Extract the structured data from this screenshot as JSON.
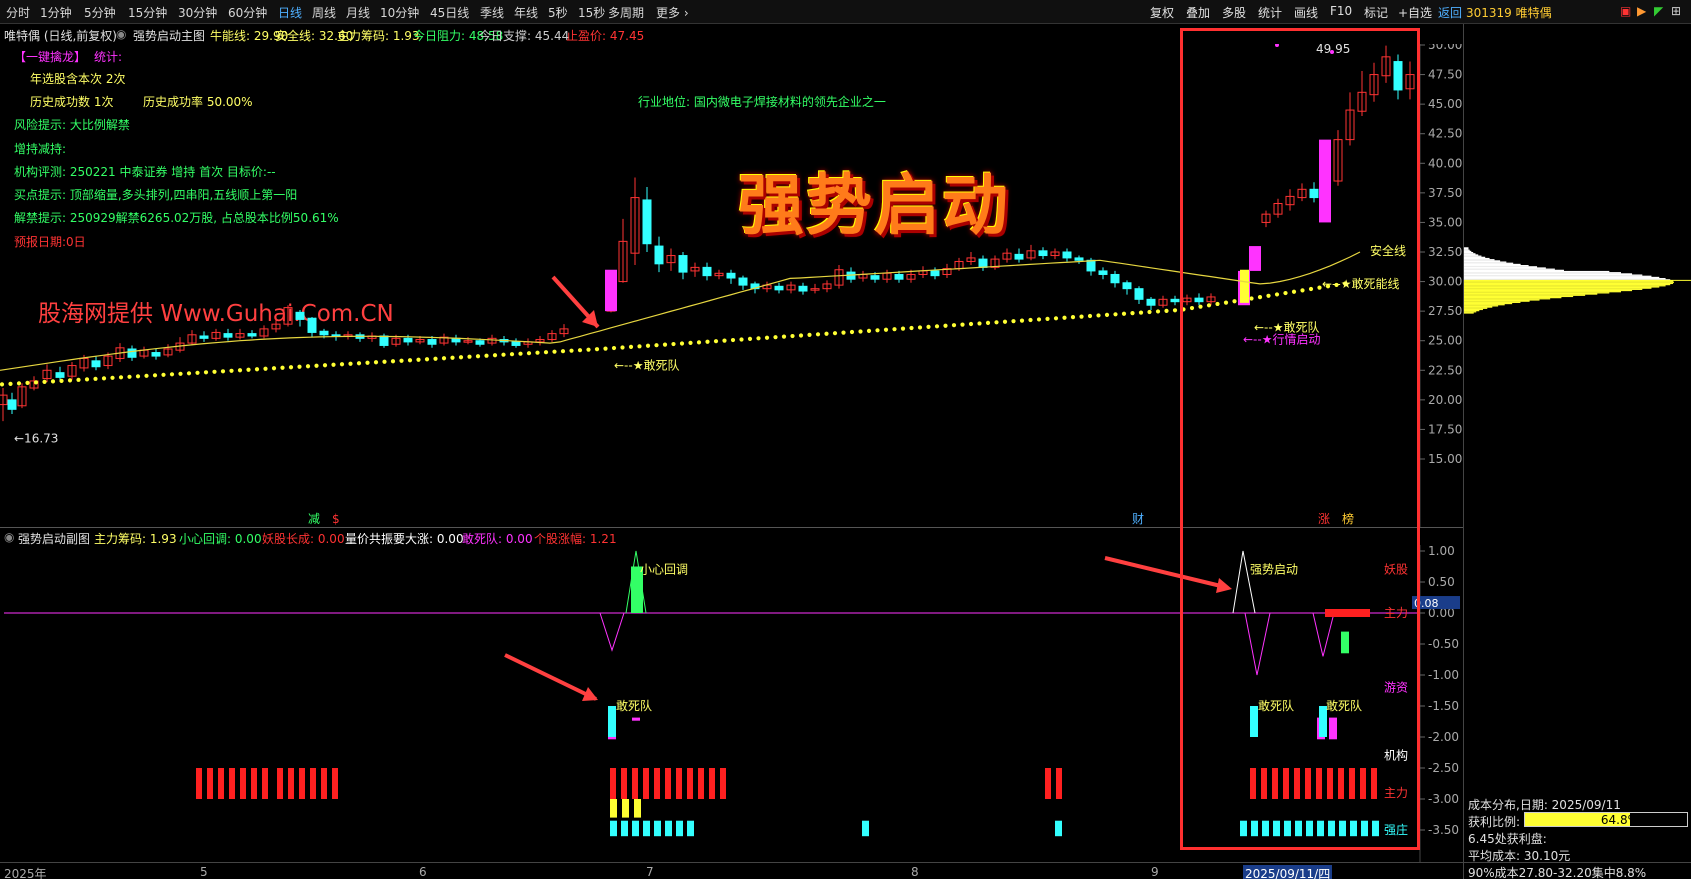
{
  "toolbar": {
    "periods": [
      "分时",
      "1分钟",
      "5分钟",
      "15分钟",
      "30分钟",
      "60分钟",
      "日线",
      "周线",
      "月线",
      "10分钟",
      "45日线",
      "季线",
      "年线",
      "5秒",
      "15秒",
      "多周期",
      "更多 ›"
    ],
    "active": "日线",
    "right_items": [
      "复权",
      "叠加",
      "多股",
      "统计",
      "画线",
      "F10",
      "标记",
      "+自选",
      "返回"
    ]
  },
  "stock": {
    "code_name": "301319 唯特偶"
  },
  "header": {
    "title": "唯特偶 (日线,前复权)",
    "indicator": "强势启动主图",
    "items": [
      {
        "label": "牛能线:",
        "value": "29.90",
        "color": "#ffff66"
      },
      {
        "label": "安全线:",
        "value": "32.60",
        "color": "#ffff66"
      },
      {
        "label": "主力筹码:",
        "value": "1.93",
        "color": "#ffff66"
      },
      {
        "label": "今日阻力:",
        "value": "48.58",
        "color": "#33ff66"
      },
      {
        "label": "今日支撑:",
        "value": "45.44",
        "color": "#cccccc"
      },
      {
        "label": "止盈价:",
        "value": "47.45",
        "color": "#ff3333"
      }
    ]
  },
  "info": {
    "tag": "【一键擒龙】",
    "stat": "统计:",
    "year_count": "年选股含本次 2次",
    "success_count": "历史成功数 1次",
    "success_rate": "历史成功率 50.00%",
    "risk": "风险提示: 大比例解禁",
    "holding": "增持减持:",
    "rating": "机构评测: 250221 中泰证券 增持 首次 目标价:--",
    "buy": "买点提示: 顶部缩量,多头排列,四串阳,五线顺上第一阳",
    "unlock": "解禁提示: 250929解禁6265.02万股, 占总股本比例50.61%",
    "report": "预报日期:0日",
    "industry": "行业地位: 国内微电子焊接材料的领先企业之一"
  },
  "big_title": "强势启动",
  "watermark": "股海网提供 Www.Guhai.Com.CN",
  "annotations": {
    "low_price": "←16.73",
    "high_price": "49.95",
    "dare1": "←--★敢死队",
    "dare2": "←--★敢死队",
    "market_start": "←--★行情启动",
    "safe_line": "安全线",
    "dead_line": "←--★敢死能线",
    "event_jian": "减",
    "event_s": "$",
    "event_cai": "财",
    "event_zhang": "涨",
    "event_bang": "榜"
  },
  "price_axis": [
    "50.00",
    "47.50",
    "45.00",
    "42.50",
    "40.00",
    "37.50",
    "35.00",
    "32.50",
    "30.00",
    "27.50",
    "25.00",
    "22.50",
    "20.00",
    "17.50",
    "15.00"
  ],
  "sub": {
    "title": "强势启动副图",
    "items": [
      {
        "label": "主力筹码:",
        "value": "1.93",
        "color": "#ffff66"
      },
      {
        "label": "小心回调:",
        "value": "0.00",
        "color": "#33ff66"
      },
      {
        "label": "妖股长成:",
        "value": "0.00",
        "color": "#ff3333"
      },
      {
        "label": "量价共振要大涨:",
        "value": "0.00",
        "color": "#ffffff"
      },
      {
        "label": "敢死队:",
        "value": "0.00",
        "color": "#ff33ff"
      },
      {
        "label": "个股涨幅:",
        "value": "1.21",
        "color": "#ff3333"
      }
    ],
    "axis": [
      "1.00",
      "0.50",
      "0.00",
      "-0.50",
      "-1.00",
      "-1.50",
      "-2.00",
      "-2.50",
      "-3.00",
      "-3.50"
    ],
    "cur_value": "0.08",
    "labels": {
      "careful": "小心回调",
      "strong": "强势启动",
      "dare_a": "敢死队",
      "dare_b": "敢死队",
      "dare_c": "敢死队",
      "yaogu": "妖股",
      "zhuli": "主力",
      "youzi": "游资",
      "jigou": "机构",
      "zhuli2": "主力",
      "qiangzhuang": "强庄"
    }
  },
  "dates": {
    "year": "2025年",
    "m5": "5",
    "m6": "6",
    "m7": "7",
    "m8": "8",
    "m9": "9",
    "cursor": "2025/09/11/四",
    "period": "日线"
  },
  "cost": {
    "date": "成本分布,日期: 2025/09/11",
    "profit_label": "获利比例:",
    "profit_value": "64.8%",
    "profit_fraction": 0.648,
    "profit_share": "6.45处获利盘:",
    "avg": "平均成本: 30.10元",
    "range": "90%成本27.80-32.20集中8.8%"
  },
  "colors": {
    "up": "#ff3333",
    "down": "#33ffff",
    "magenta": "#ff33ff",
    "yellow": "#ffff33"
  }
}
